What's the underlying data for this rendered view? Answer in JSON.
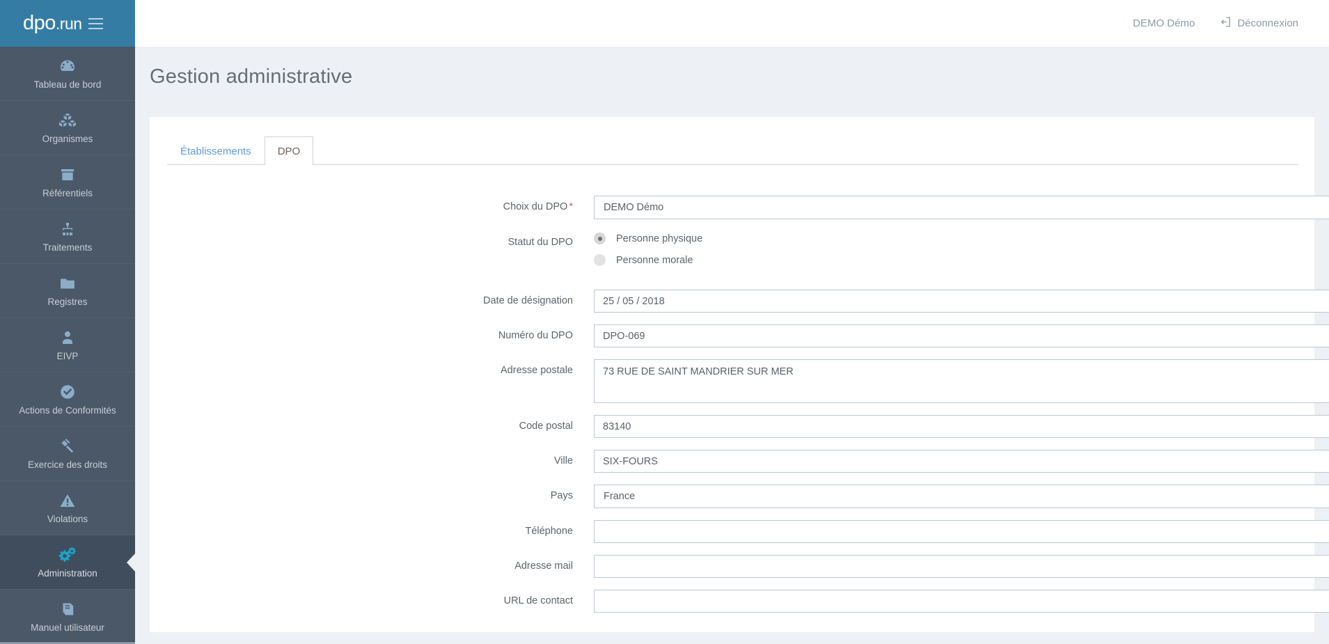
{
  "brand": {
    "name": "dpo",
    "suffix": ".run",
    "menu_icon": "hamburger-icon"
  },
  "topbar": {
    "user_name": "DEMO Démo",
    "logout_label": "Déconnexion",
    "logout_icon": "logout-icon"
  },
  "sidebar": {
    "items": [
      {
        "label": "Tableau de bord",
        "icon": "dashboard-gauge-icon",
        "active": false
      },
      {
        "label": "Organismes",
        "icon": "boxes-icon",
        "active": false
      },
      {
        "label": "Référentiels",
        "icon": "archive-box-icon",
        "active": false
      },
      {
        "label": "Traitements",
        "icon": "sitemap-icon",
        "active": false
      },
      {
        "label": "Registres",
        "icon": "folder-icon",
        "active": false
      },
      {
        "label": "EIVP",
        "icon": "user-icon",
        "active": false
      },
      {
        "label": "Actions de Conformités",
        "icon": "check-circle-icon",
        "active": false
      },
      {
        "label": "Exercice des droits",
        "icon": "gavel-icon",
        "active": false
      },
      {
        "label": "Violations",
        "icon": "warning-triangle-icon",
        "active": false
      },
      {
        "label": "Administration",
        "icon": "gears-icon",
        "active": true
      },
      {
        "label": "Manuel utilisateur",
        "icon": "book-icon",
        "active": false
      }
    ]
  },
  "page": {
    "title": "Gestion administrative"
  },
  "tabs": [
    {
      "label": "Établissements",
      "active": false
    },
    {
      "label": "DPO",
      "active": true
    }
  ],
  "form": {
    "choix_dpo": {
      "label": "Choix du DPO",
      "required_mark": "*",
      "value": "DEMO Démo",
      "options": [
        "DEMO Démo"
      ]
    },
    "statut_dpo": {
      "label": "Statut du DPO",
      "options": [
        {
          "label": "Personne physique",
          "checked": true
        },
        {
          "label": "Personne morale",
          "checked": false
        }
      ]
    },
    "date_designation": {
      "label": "Date de désignation",
      "value": "25 / 05 / 2018",
      "clear_icon": "clear-circle-icon"
    },
    "numero_dpo": {
      "label": "Numéro du DPO",
      "value": "DPO-069",
      "placeholder": ""
    },
    "adresse_postale": {
      "label": "Adresse postale",
      "value": "73 RUE DE SAINT MANDRIER SUR MER",
      "placeholder": ""
    },
    "code_postal": {
      "label": "Code postal",
      "value": "83140",
      "placeholder": ""
    },
    "ville": {
      "label": "Ville",
      "value": "SIX-FOURS",
      "placeholder": ""
    },
    "pays": {
      "label": "Pays",
      "value": "France",
      "options": [
        "France"
      ]
    },
    "telephone": {
      "label": "Téléphone",
      "value": "",
      "placeholder": ""
    },
    "adresse_mail": {
      "label": "Adresse mail",
      "value": "",
      "placeholder": ""
    },
    "url_contact": {
      "label": "URL de contact",
      "value": "",
      "placeholder": ""
    }
  },
  "colors": {
    "brand_blue": "#357ca5",
    "sidebar_bg": "#4a5868",
    "sidebar_active_bg": "#404d5c",
    "accent_cyan": "#1ba5c8",
    "page_bg": "#edf0f5",
    "icon_blue": "#8badc8",
    "required_red": "#e05a4f",
    "tab_link_blue": "#5b9bd5"
  }
}
